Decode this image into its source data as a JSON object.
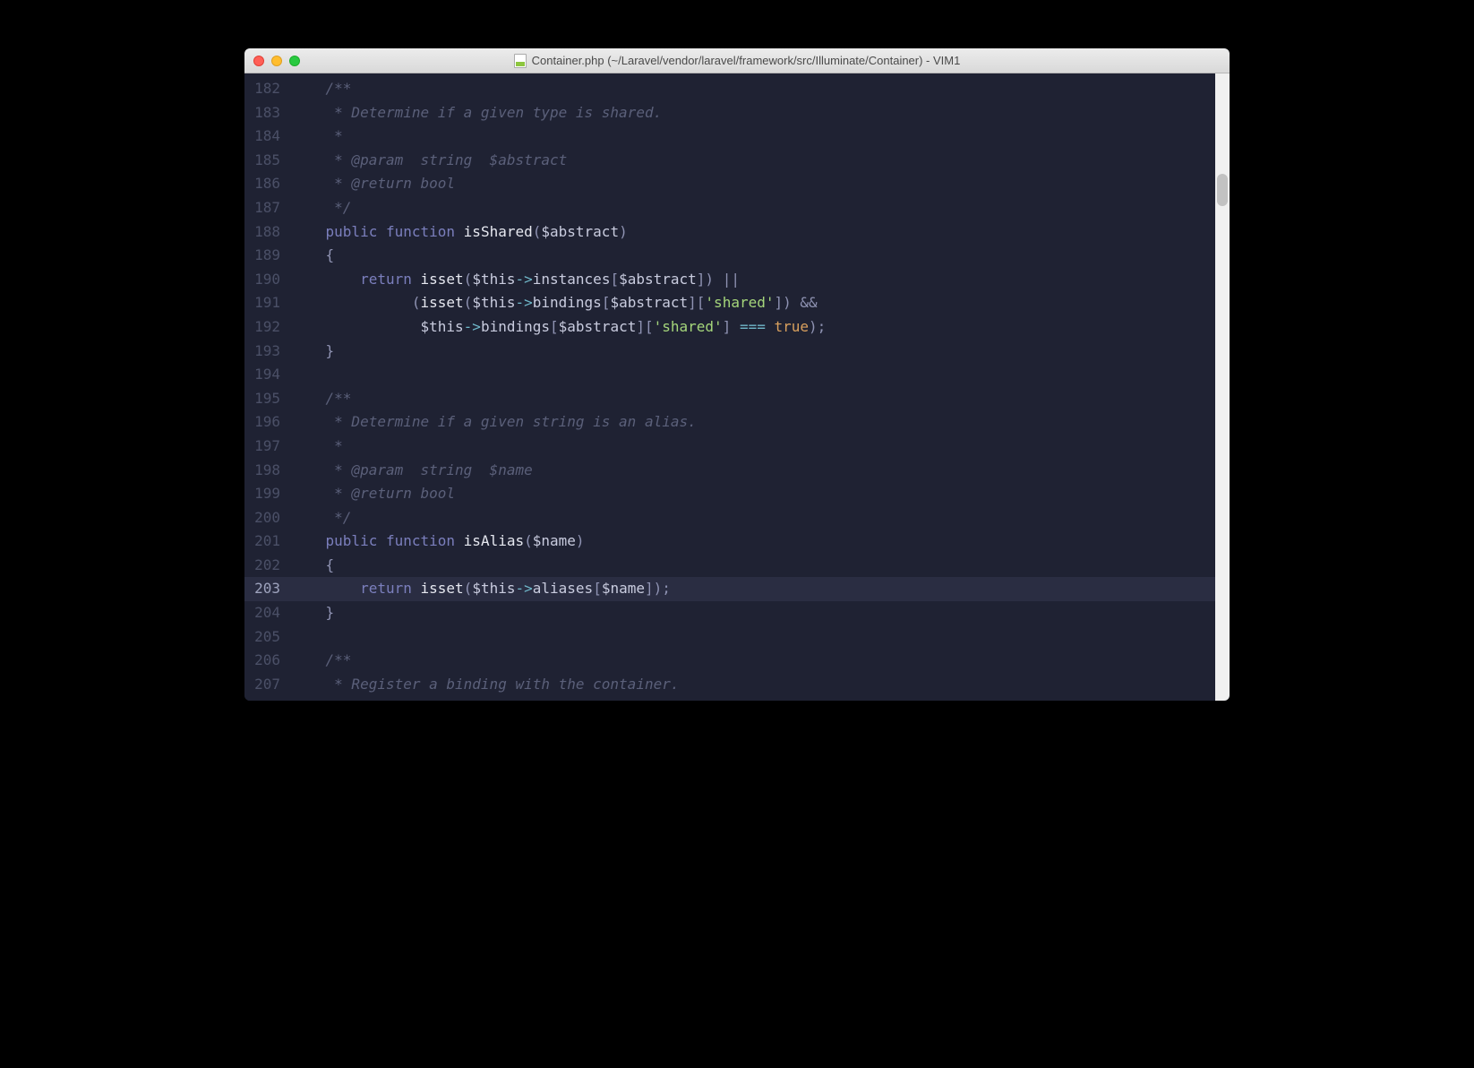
{
  "window": {
    "title": "Container.php (~/Laravel/vendor/laravel/framework/src/Illuminate/Container) - VIM1"
  },
  "editor": {
    "highlight_line": 203,
    "lines": [
      {
        "n": 182,
        "tokens": [
          {
            "t": "    /**",
            "c": "c-comment"
          }
        ]
      },
      {
        "n": 183,
        "tokens": [
          {
            "t": "     * Determine if a given type is shared.",
            "c": "c-comment"
          }
        ]
      },
      {
        "n": 184,
        "tokens": [
          {
            "t": "     *",
            "c": "c-comment"
          }
        ]
      },
      {
        "n": 185,
        "tokens": [
          {
            "t": "     * @param  string  $abstract",
            "c": "c-comment"
          }
        ]
      },
      {
        "n": 186,
        "tokens": [
          {
            "t": "     * @return bool",
            "c": "c-comment"
          }
        ]
      },
      {
        "n": 187,
        "tokens": [
          {
            "t": "     */",
            "c": "c-comment"
          }
        ]
      },
      {
        "n": 188,
        "tokens": [
          {
            "t": "    ",
            "c": ""
          },
          {
            "t": "public",
            "c": "c-keyword"
          },
          {
            "t": " ",
            "c": ""
          },
          {
            "t": "function",
            "c": "c-keyword"
          },
          {
            "t": " ",
            "c": ""
          },
          {
            "t": "isShared",
            "c": "c-func"
          },
          {
            "t": "(",
            "c": "c-paren"
          },
          {
            "t": "$abstract",
            "c": "c-var"
          },
          {
            "t": ")",
            "c": "c-paren"
          }
        ]
      },
      {
        "n": 189,
        "tokens": [
          {
            "t": "    {",
            "c": "c-paren"
          }
        ]
      },
      {
        "n": 190,
        "tokens": [
          {
            "t": "        ",
            "c": ""
          },
          {
            "t": "return",
            "c": "c-keyword"
          },
          {
            "t": " ",
            "c": ""
          },
          {
            "t": "isset",
            "c": "c-func"
          },
          {
            "t": "(",
            "c": "c-paren"
          },
          {
            "t": "$this",
            "c": "c-var"
          },
          {
            "t": "->",
            "c": "c-op"
          },
          {
            "t": "instances",
            "c": "c-var"
          },
          {
            "t": "[",
            "c": "c-paren"
          },
          {
            "t": "$abstract",
            "c": "c-var"
          },
          {
            "t": "]) ||",
            "c": "c-paren"
          }
        ]
      },
      {
        "n": 191,
        "tokens": [
          {
            "t": "              (",
            "c": "c-paren"
          },
          {
            "t": "isset",
            "c": "c-func"
          },
          {
            "t": "(",
            "c": "c-paren"
          },
          {
            "t": "$this",
            "c": "c-var"
          },
          {
            "t": "->",
            "c": "c-op"
          },
          {
            "t": "bindings",
            "c": "c-var"
          },
          {
            "t": "[",
            "c": "c-paren"
          },
          {
            "t": "$abstract",
            "c": "c-var"
          },
          {
            "t": "][",
            "c": "c-paren"
          },
          {
            "t": "'shared'",
            "c": "c-string"
          },
          {
            "t": "]) &&",
            "c": "c-paren"
          }
        ]
      },
      {
        "n": 192,
        "tokens": [
          {
            "t": "               ",
            "c": ""
          },
          {
            "t": "$this",
            "c": "c-var"
          },
          {
            "t": "->",
            "c": "c-op"
          },
          {
            "t": "bindings",
            "c": "c-var"
          },
          {
            "t": "[",
            "c": "c-paren"
          },
          {
            "t": "$abstract",
            "c": "c-var"
          },
          {
            "t": "][",
            "c": "c-paren"
          },
          {
            "t": "'shared'",
            "c": "c-string"
          },
          {
            "t": "] ",
            "c": "c-paren"
          },
          {
            "t": "===",
            "c": "c-op"
          },
          {
            "t": " ",
            "c": ""
          },
          {
            "t": "true",
            "c": "c-const"
          },
          {
            "t": ");",
            "c": "c-paren"
          }
        ]
      },
      {
        "n": 193,
        "tokens": [
          {
            "t": "    }",
            "c": "c-paren"
          }
        ]
      },
      {
        "n": 194,
        "tokens": [
          {
            "t": "",
            "c": ""
          }
        ]
      },
      {
        "n": 195,
        "tokens": [
          {
            "t": "    /**",
            "c": "c-comment"
          }
        ]
      },
      {
        "n": 196,
        "tokens": [
          {
            "t": "     * Determine if a given string is an alias.",
            "c": "c-comment"
          }
        ]
      },
      {
        "n": 197,
        "tokens": [
          {
            "t": "     *",
            "c": "c-comment"
          }
        ]
      },
      {
        "n": 198,
        "tokens": [
          {
            "t": "     * @param  string  $name",
            "c": "c-comment"
          }
        ]
      },
      {
        "n": 199,
        "tokens": [
          {
            "t": "     * @return bool",
            "c": "c-comment"
          }
        ]
      },
      {
        "n": 200,
        "tokens": [
          {
            "t": "     */",
            "c": "c-comment"
          }
        ]
      },
      {
        "n": 201,
        "tokens": [
          {
            "t": "    ",
            "c": ""
          },
          {
            "t": "public",
            "c": "c-keyword"
          },
          {
            "t": " ",
            "c": ""
          },
          {
            "t": "function",
            "c": "c-keyword"
          },
          {
            "t": " ",
            "c": ""
          },
          {
            "t": "isAlias",
            "c": "c-func"
          },
          {
            "t": "(",
            "c": "c-paren"
          },
          {
            "t": "$name",
            "c": "c-var"
          },
          {
            "t": ")",
            "c": "c-paren"
          }
        ]
      },
      {
        "n": 202,
        "tokens": [
          {
            "t": "    {",
            "c": "c-paren"
          }
        ]
      },
      {
        "n": 203,
        "tokens": [
          {
            "t": "        ",
            "c": ""
          },
          {
            "t": "return",
            "c": "c-keyword"
          },
          {
            "t": " ",
            "c": ""
          },
          {
            "t": "isset",
            "c": "c-func"
          },
          {
            "t": "(",
            "c": "c-paren"
          },
          {
            "t": "$this",
            "c": "c-var"
          },
          {
            "t": "->",
            "c": "c-op"
          },
          {
            "t": "aliases",
            "c": "c-var"
          },
          {
            "t": "[",
            "c": "c-paren"
          },
          {
            "t": "$name",
            "c": "c-var"
          },
          {
            "t": "]);",
            "c": "c-paren"
          }
        ]
      },
      {
        "n": 204,
        "tokens": [
          {
            "t": "    }",
            "c": "c-paren"
          }
        ]
      },
      {
        "n": 205,
        "tokens": [
          {
            "t": "",
            "c": ""
          }
        ]
      },
      {
        "n": 206,
        "tokens": [
          {
            "t": "    /**",
            "c": "c-comment"
          }
        ]
      },
      {
        "n": 207,
        "tokens": [
          {
            "t": "     * Register a binding with the container.",
            "c": "c-comment"
          }
        ]
      }
    ]
  }
}
